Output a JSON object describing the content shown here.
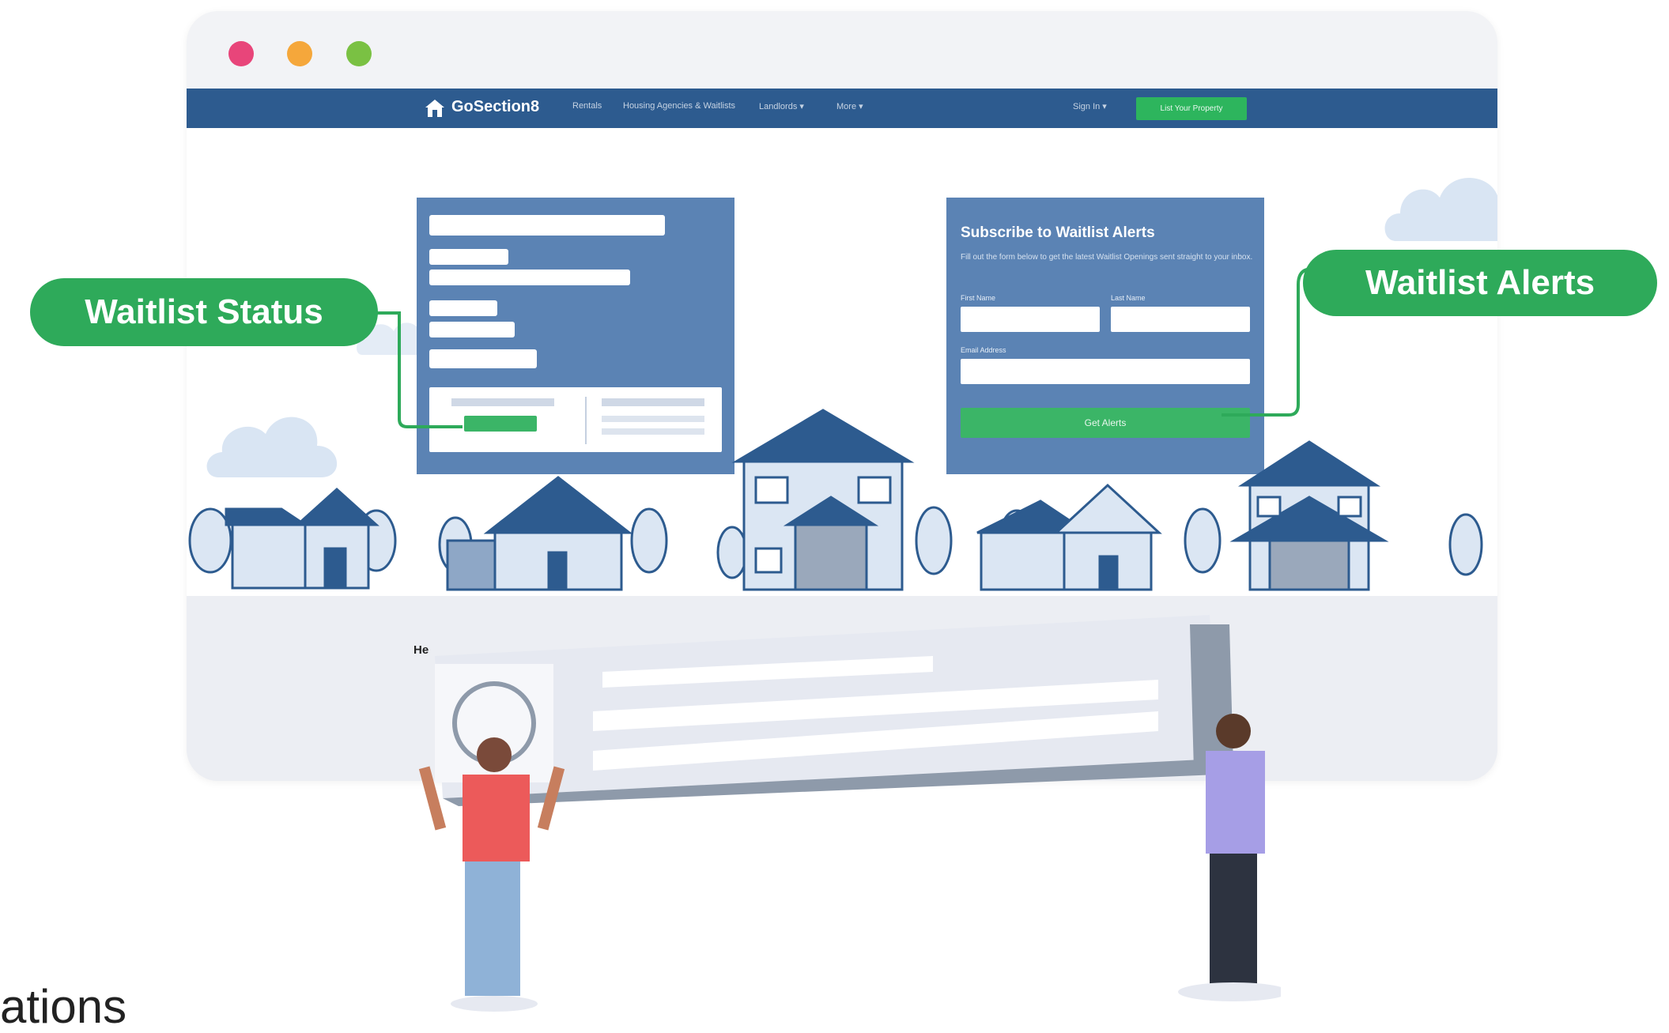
{
  "browser": {
    "traffic_lights": {
      "red": "#e8457a",
      "yellow": "#f5a73b",
      "green": "#7ac143"
    }
  },
  "navbar": {
    "logo": "GoSection8",
    "links": [
      "Rentals",
      "Housing Agencies & Waitlists",
      "Landlords ▾",
      "More ▾"
    ],
    "signin": "Sign In ▾",
    "cta": "List Your Property",
    "bg_color": "#2d5b8f",
    "accent": "#2db55d"
  },
  "alerts_panel": {
    "title": "Subscribe to Waitlist Alerts",
    "description": "Fill out the form below to get the latest Waitlist Openings sent straight to your inbox.",
    "first_name_label": "First Name",
    "last_name_label": "Last Name",
    "email_label": "Email Address",
    "button": "Get Alerts"
  },
  "callouts": {
    "left": "Waitlist Status",
    "right": "Waitlist Alerts",
    "color": "#2eaa5a"
  },
  "lower": {
    "heading_fragment": "He"
  },
  "bottom_text": "ations"
}
